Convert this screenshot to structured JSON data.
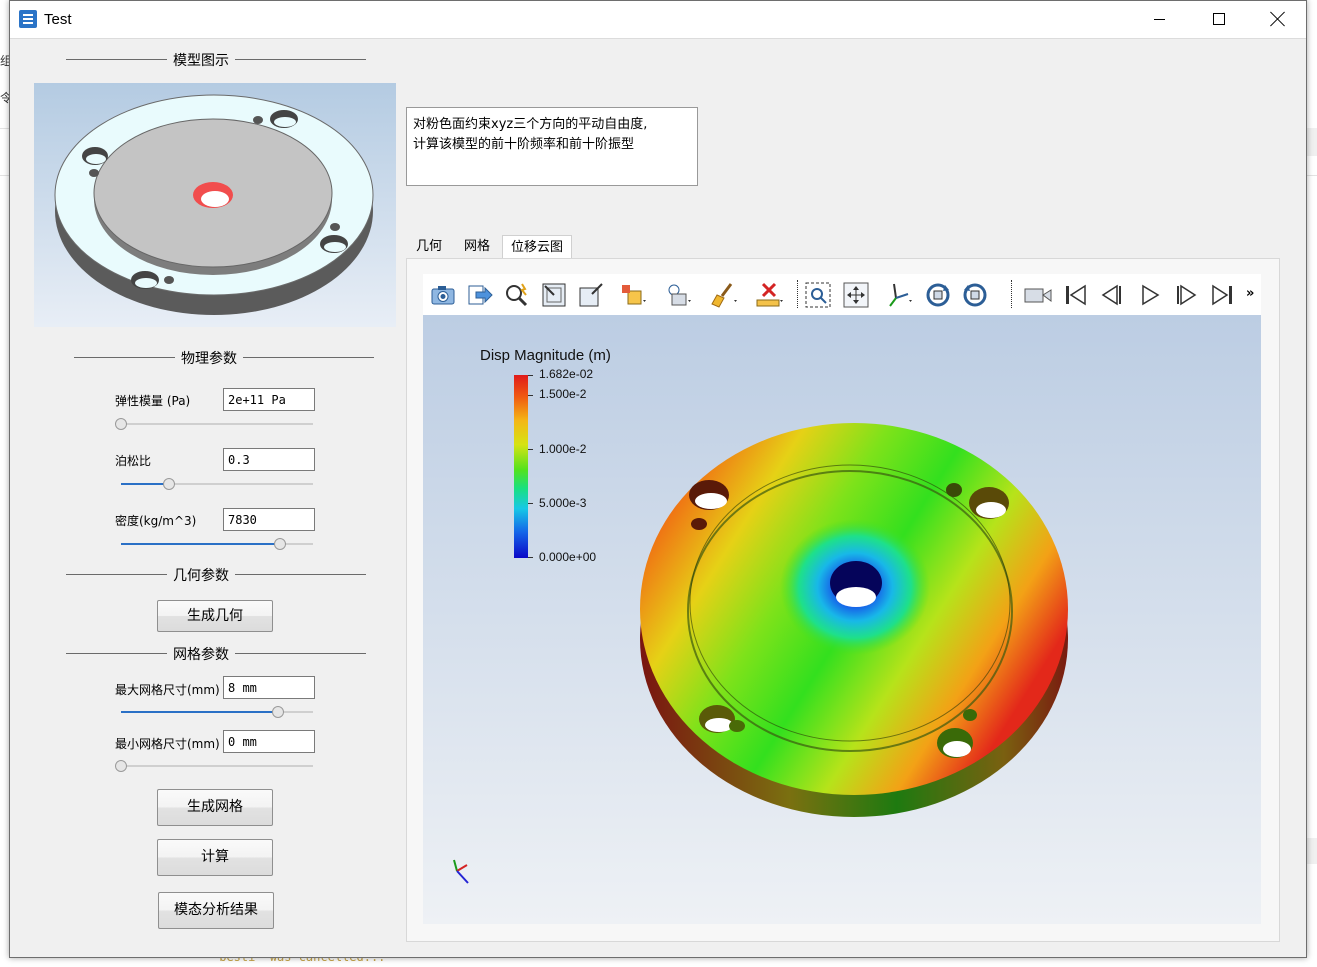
{
  "window": {
    "title": "Test"
  },
  "background_app": {
    "left_chars": [
      "组",
      "令"
    ],
    "bottom_text": "'besti' was cancelled..."
  },
  "groups": {
    "model": "模型图示",
    "physics": "物理参数",
    "geometry": "几何参数",
    "mesh": "网格参数"
  },
  "physics": {
    "youngs": {
      "label": "弹性模量 (Pa)",
      "value": "2e+11 Pa",
      "slider": 0.0
    },
    "poisson": {
      "label": "泊松比",
      "value": "0.3",
      "slider": 0.25
    },
    "density": {
      "label": "密度(kg/m^3)",
      "value": "7830",
      "slider": 0.83
    }
  },
  "buttons": {
    "gen_geometry": "生成几何",
    "gen_mesh": "生成网格",
    "compute": "计算",
    "modal_results": "模态分析结果"
  },
  "mesh": {
    "max_size": {
      "label": "最大网格尺寸(mm)",
      "value": "8 mm",
      "slider": 0.82
    },
    "min_size": {
      "label": "最小网格尺寸(mm)",
      "value": "0 mm",
      "slider": 0.0
    }
  },
  "description": {
    "line1": "对粉色面约束xyz三个方向的平动自由度,",
    "line2": "计算该模型的前十阶频率和前十阶振型"
  },
  "tabs": [
    {
      "label": "几何",
      "active": false
    },
    {
      "label": "网格",
      "active": false
    },
    {
      "label": "位移云图",
      "active": true
    }
  ],
  "toolbar": {
    "icons": [
      "camera-icon",
      "export-icon",
      "magnify-icon",
      "reset-view-icon",
      "view-box-icon",
      "object-icon",
      "light-icon",
      "paint-icon",
      "remove-icon",
      "zoom-box-icon",
      "pan-icon",
      "axes-icon",
      "rotate-cw-icon",
      "rotate-ccw-icon",
      "video-icon",
      "first-frame-icon",
      "prev-frame-icon",
      "play-icon",
      "next-frame-icon",
      "last-frame-icon"
    ],
    "more": "»"
  },
  "colorbar": {
    "title": "Disp Magnitude (m)",
    "ticks": [
      "1.682e-02",
      "1.500e-2",
      "1.000e-2",
      "5.000e-3",
      "0.000e+00"
    ],
    "colors": {
      "max": "#e01a1a",
      "mid": "#52e21e",
      "min": "#0c08c8"
    }
  }
}
